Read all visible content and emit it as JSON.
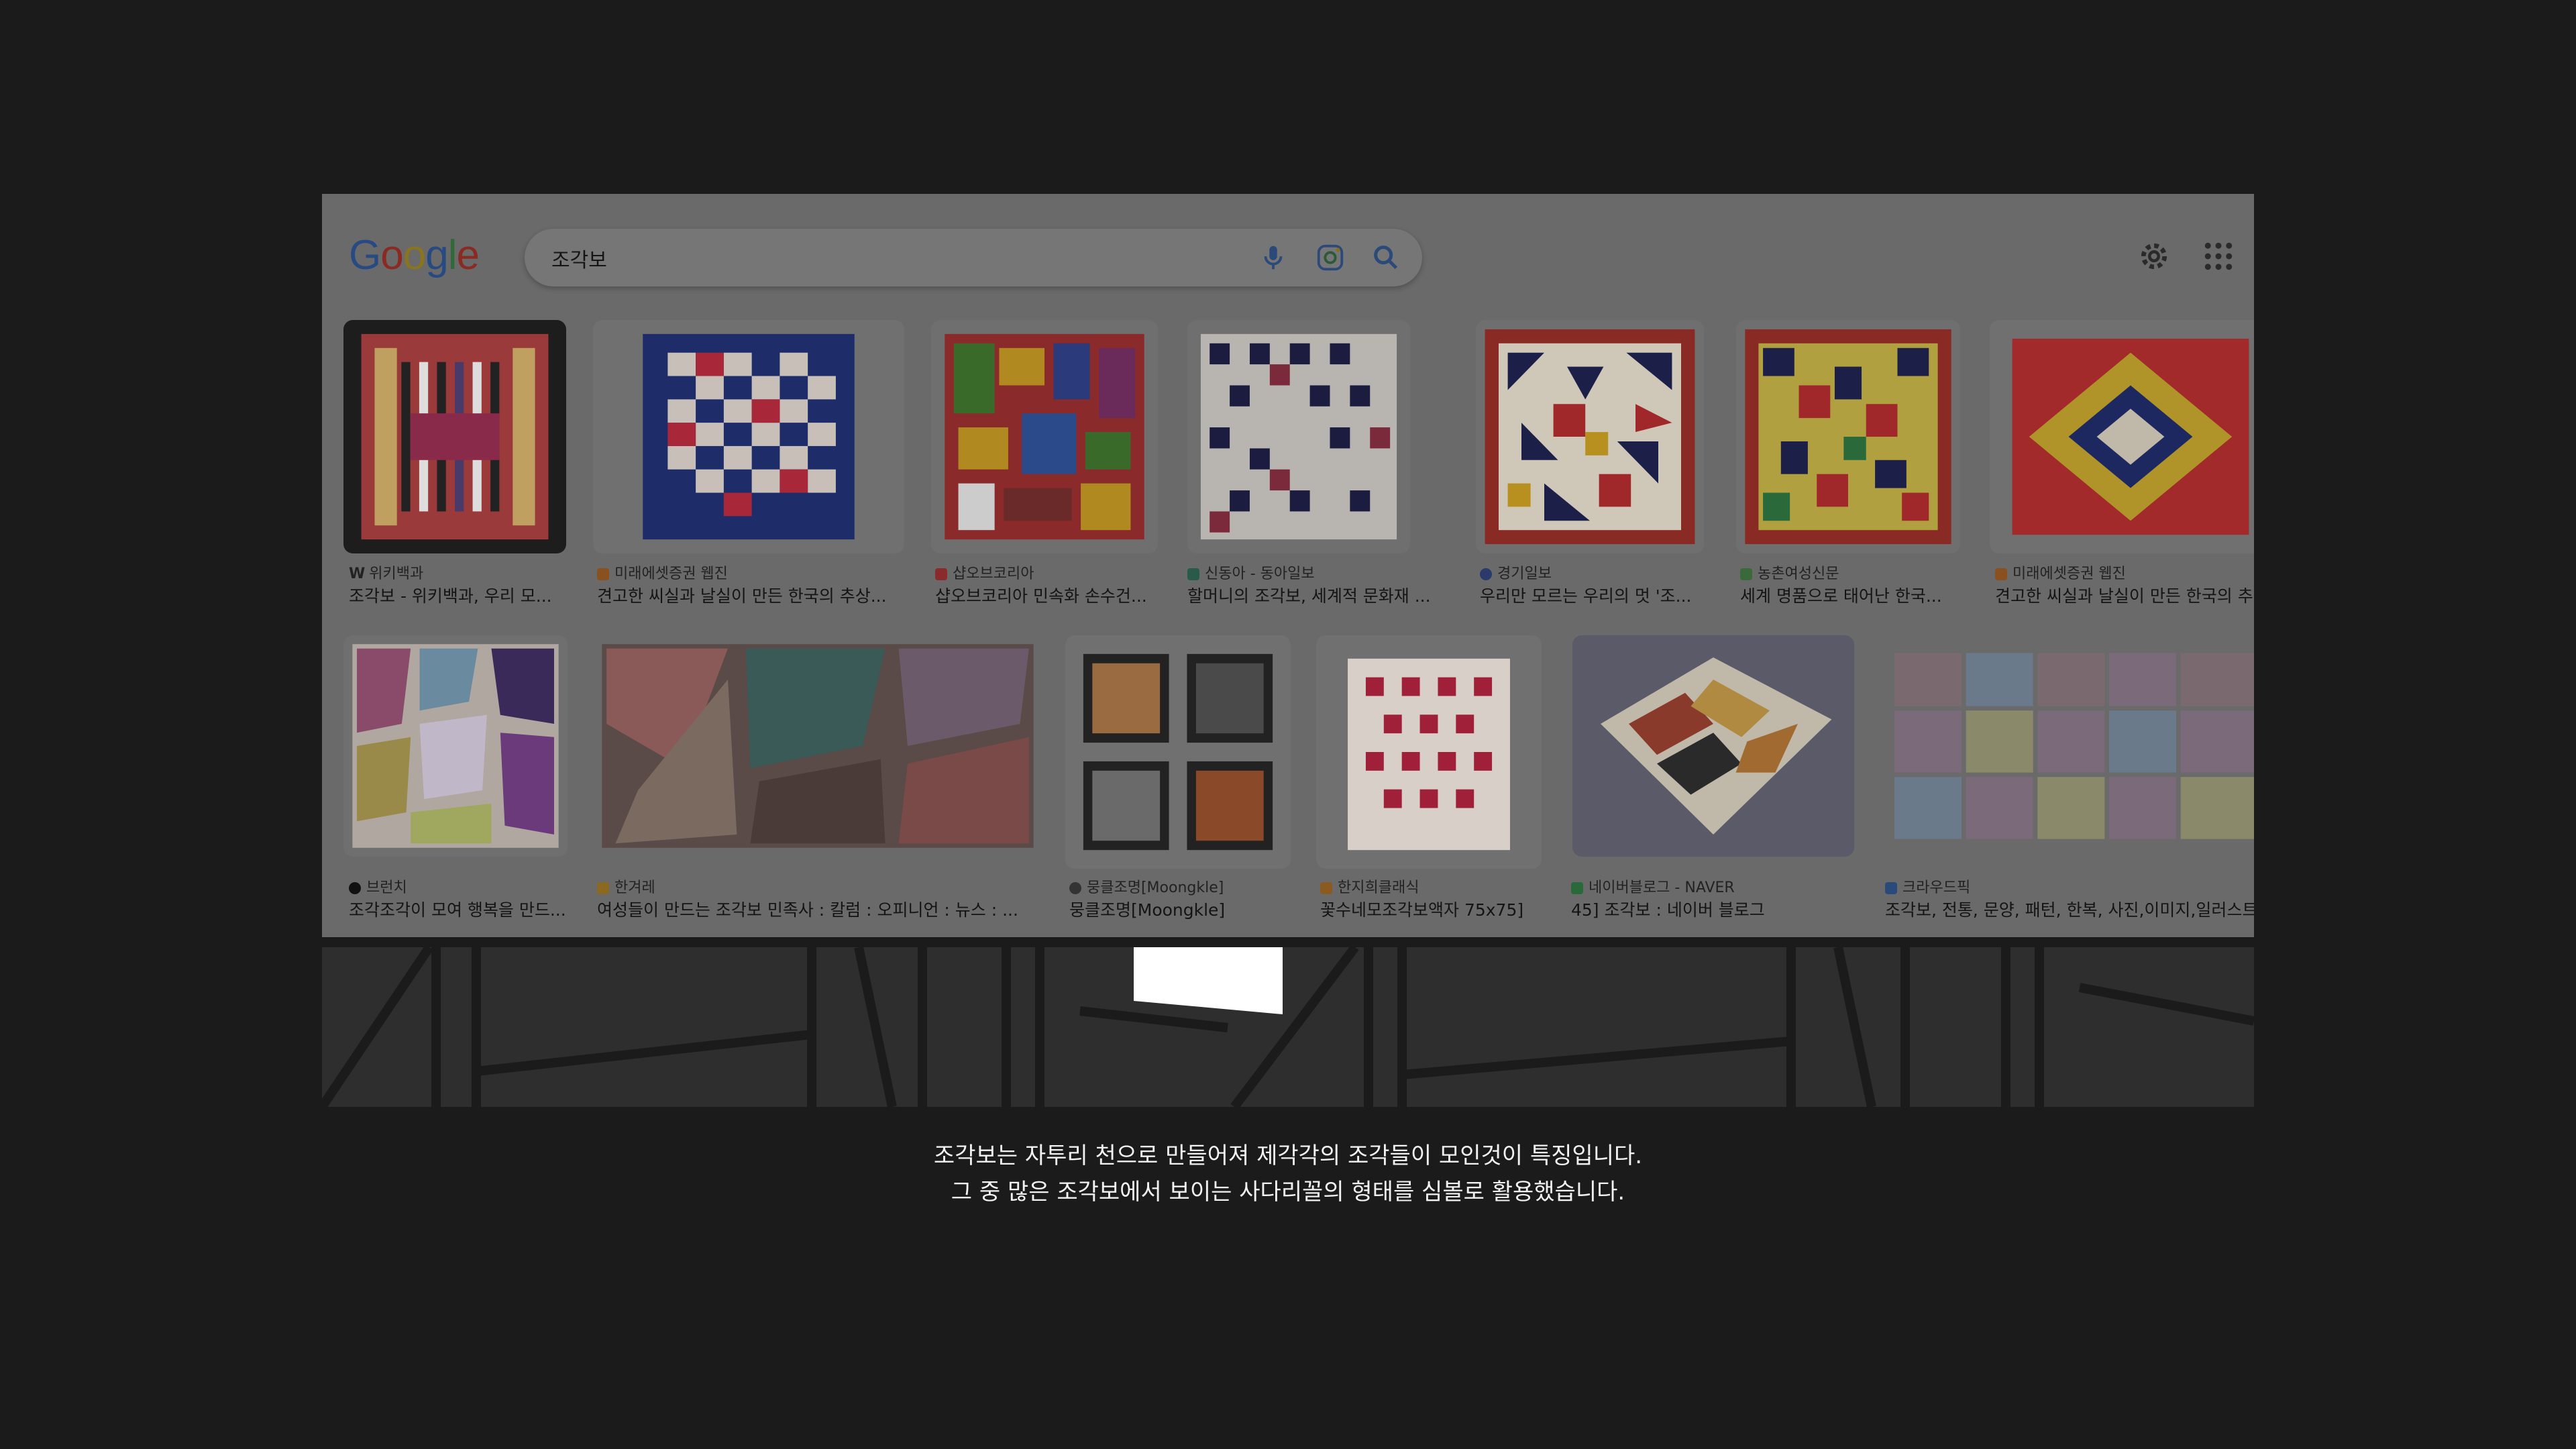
{
  "search": {
    "query": "조각보",
    "logo_letters": [
      "G",
      "o",
      "o",
      "g",
      "l",
      "e"
    ],
    "logo_colors": [
      "#274a82",
      "#8a2a22",
      "#8a7420",
      "#274a82",
      "#2f6a38",
      "#8a2a22"
    ],
    "icons": [
      "mic-icon",
      "lens-icon",
      "search-icon"
    ]
  },
  "header_icons": [
    "settings-gear-icon",
    "apps-grid-icon"
  ],
  "results_row1": [
    {
      "source": "위키백과",
      "title": "조각보 - 위키백과, 우리 모...",
      "badge": "W"
    },
    {
      "source": "미래에셋증권 웹진",
      "title": "견고한 씨실과 날실이 만든 한국의 추상...",
      "badge": ""
    },
    {
      "source": "샵오브코리아",
      "title": "샵오브코리아 민속화 손수건...",
      "badge": ""
    },
    {
      "source": "신동아 - 동아일보",
      "title": "할머니의 조각보, 세계적 문화재 ...",
      "badge": ""
    },
    {
      "source": "경기일보",
      "title": "우리만 모르는 우리의 멋 '조...",
      "badge": ""
    },
    {
      "source": "농촌여성신문",
      "title": "세계 명품으로 태어난 한국...",
      "badge": ""
    },
    {
      "source": "미래에셋증권 웹진",
      "title": "견고한 씨실과 날실이 만든 한국의 추상",
      "badge": ""
    }
  ],
  "results_row2": [
    {
      "source": "브런치",
      "title": "조각조각이 모여 행복을 만드..."
    },
    {
      "source": "한겨레",
      "title": "여성들이 만드는 조각보 민족사 : 칼럼 : 오피니언 : 뉴스 : ..."
    },
    {
      "source": "뭉클조명[Moongkle]",
      "title": "뭉클조명[Moongkle]"
    },
    {
      "source": "한지희클래식",
      "title": "꽃수네모조각보액자 75x75]"
    },
    {
      "source": "네이버블로그 - NAVER",
      "title": "45] 조각보 : 네이버 블로그"
    },
    {
      "source": "크라우드픽",
      "title": "조각보, 전통, 문양, 패턴, 한복, 사진,이미지,일러스트"
    }
  ],
  "caption": {
    "line1": "조각보는 자투리 천으로 만들어져 제각각의 조각들이 모인것이 특징입니다.",
    "line2": "그 중 많은 조각보에서 보이는 사다리꼴의 형태를 심볼로 활용했습니다."
  }
}
